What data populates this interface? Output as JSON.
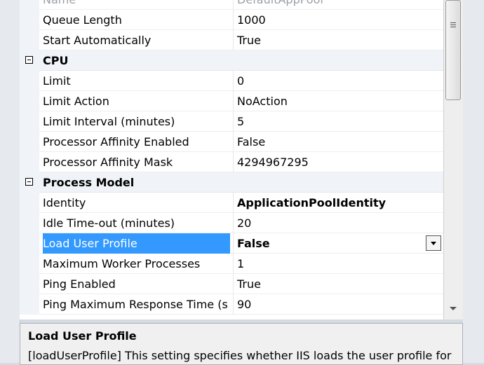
{
  "rows": [
    {
      "type": "prop",
      "name": "Name",
      "value": "DefaultAppPool",
      "dim": true
    },
    {
      "type": "prop",
      "name": "Queue Length",
      "value": "1000"
    },
    {
      "type": "prop",
      "name": "Start Automatically",
      "value": "True"
    },
    {
      "type": "category",
      "name": "CPU"
    },
    {
      "type": "prop",
      "name": "Limit",
      "value": "0"
    },
    {
      "type": "prop",
      "name": "Limit Action",
      "value": "NoAction"
    },
    {
      "type": "prop",
      "name": "Limit Interval (minutes)",
      "value": "5"
    },
    {
      "type": "prop",
      "name": "Processor Affinity Enabled",
      "value": "False"
    },
    {
      "type": "prop",
      "name": "Processor Affinity Mask",
      "value": "4294967295"
    },
    {
      "type": "category",
      "name": "Process Model"
    },
    {
      "type": "prop",
      "name": "Identity",
      "value": "ApplicationPoolIdentity",
      "bold": true
    },
    {
      "type": "prop",
      "name": "Idle Time-out (minutes)",
      "value": "20"
    },
    {
      "type": "prop",
      "name": "Load User Profile",
      "value": "False",
      "bold": true,
      "selected": true
    },
    {
      "type": "prop",
      "name": "Maximum Worker Processes",
      "value": "1"
    },
    {
      "type": "prop",
      "name": "Ping Enabled",
      "value": "True"
    },
    {
      "type": "prop",
      "name": "Ping Maximum Response Time (s",
      "value": "90"
    }
  ],
  "description": {
    "title": "Load User Profile",
    "text": "[loadUserProfile] This setting specifies whether IIS loads the user profile for"
  },
  "icons": {
    "expander": "collapse-icon",
    "dropdown": "chevron-down-icon",
    "scroll": "scrollbar-grip-icon"
  }
}
